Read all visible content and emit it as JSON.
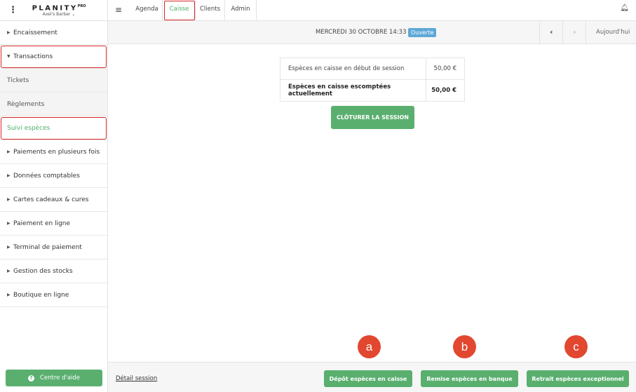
{
  "brand": {
    "name": "PLANITY",
    "pro": "PRO",
    "salon": "Axel's Barber ⌄"
  },
  "sidebar": {
    "items": [
      {
        "label": "Encaissement"
      },
      {
        "label": "Transactions"
      },
      {
        "label": "Tickets"
      },
      {
        "label": "Règlements"
      },
      {
        "label": "Suivi espèces"
      },
      {
        "label": "Paiements en plusieurs fois"
      },
      {
        "label": "Données comptables"
      },
      {
        "label": "Cartes cadeaux & cures"
      },
      {
        "label": "Paiement en ligne"
      },
      {
        "label": "Terminal de paiement"
      },
      {
        "label": "Gestion des stocks"
      },
      {
        "label": "Boutique en ligne"
      }
    ],
    "help_label": "Centre d'aide"
  },
  "tabs": [
    {
      "label": "Agenda"
    },
    {
      "label": "Caisse"
    },
    {
      "label": "Clients"
    },
    {
      "label": "Admin"
    }
  ],
  "datebar": {
    "date": "MERCREDI 30 OCTOBRE 14:33",
    "status": "Ouverte",
    "today_label": "Aujourd'hui"
  },
  "cash": {
    "rows": [
      {
        "label": "Espèces en caisse en début de session",
        "amount": "50,00 €"
      },
      {
        "label": "Espèces en caisse escomptées actuellement",
        "amount": "50,00 €"
      }
    ],
    "close_label": "CLÔTURER LA SESSION"
  },
  "callouts": [
    "a",
    "b",
    "c"
  ],
  "footer": {
    "detail_label": "Détail session",
    "deposit_label": "Dépôt espèces en caisse",
    "bank_label": "Remise espèces en banque",
    "withdraw_label": "Retrait espèces exceptionnel"
  },
  "colors": {
    "accent": "#5aaf6f",
    "badge": "#5fa8d8",
    "callout": "#e2472f",
    "highlight": "#d62828"
  }
}
